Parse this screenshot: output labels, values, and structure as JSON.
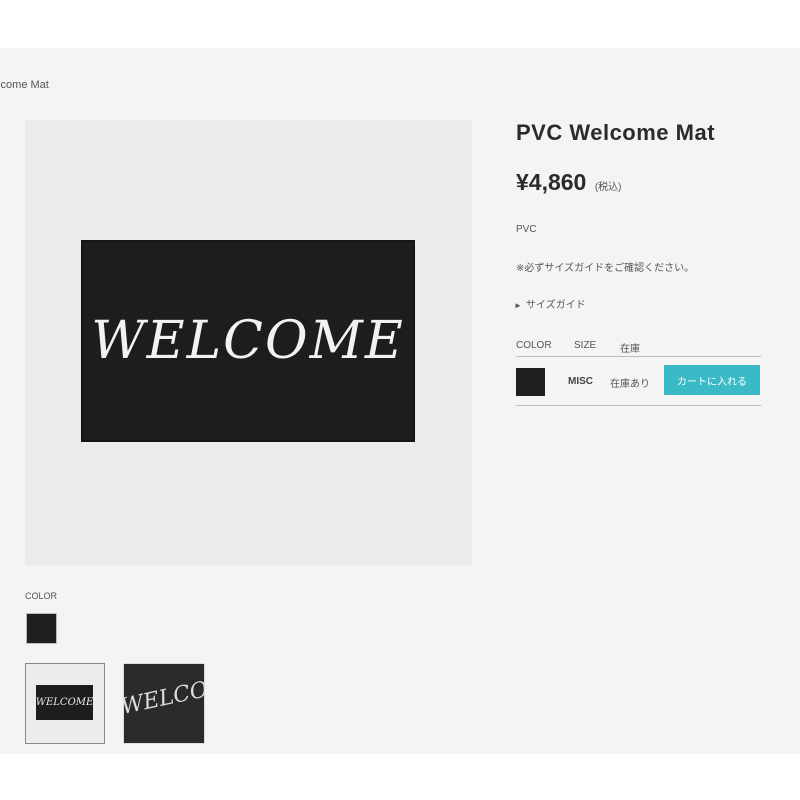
{
  "breadcrumb": "elcome Mat",
  "main_image": {
    "mat_text": "WELCOME"
  },
  "color_section": {
    "label": "COLOR"
  },
  "thumbnails": [
    {
      "mat_text": "WELCOME"
    },
    {
      "mat_text": "WELCOME"
    }
  ],
  "product": {
    "title": "PVC Welcome Mat",
    "price": "¥4,860",
    "tax_note": "(税込)",
    "material": "PVC",
    "size_notice": "※必ずサイズガイドをご確認ください。",
    "size_guide_link": "サイズガイド"
  },
  "variants": {
    "headers": [
      "COLOR",
      "SIZE",
      "在庫"
    ],
    "rows": [
      {
        "color": "#1f1f1f",
        "size": "MISC",
        "stock": "在庫あり",
        "cart_label": "カートに入れる"
      }
    ]
  },
  "colors": {
    "accent": "#3ab9c6",
    "mat": "#1d1d1d",
    "background": "#f4f4f4"
  },
  "icons": {
    "size_guide": "chevron-right-icon"
  }
}
